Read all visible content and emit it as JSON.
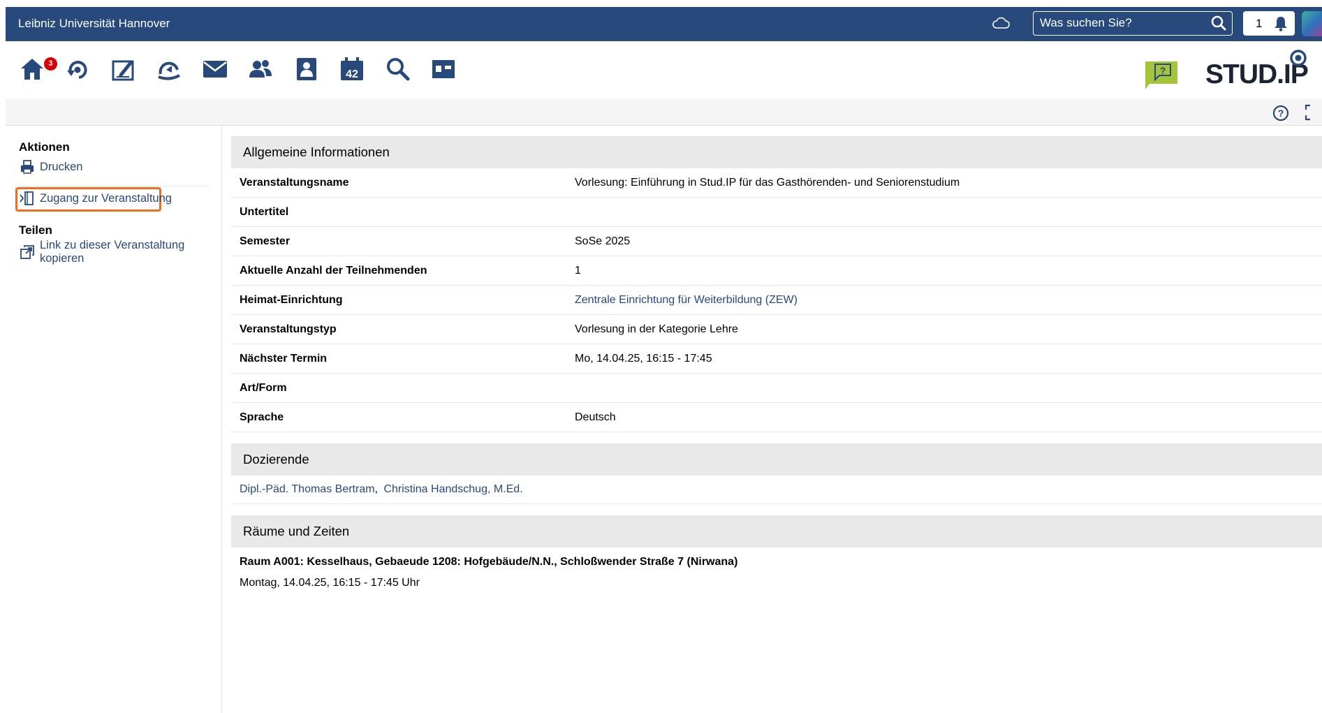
{
  "topbar": {
    "university": "Leibniz Universität Hannover",
    "search_placeholder": "Was suchen Sie?",
    "notification_count": "1"
  },
  "nav": {
    "home_badge": "3",
    "icons": [
      "home-icon",
      "courses-icon",
      "edit-icon",
      "community-icon",
      "mail-icon",
      "contacts-icon",
      "profile-icon",
      "calendar-icon",
      "search-icon",
      "files-icon"
    ],
    "calendar_day": "42",
    "logo": "STUD.IP"
  },
  "sidebar": {
    "actions_title": "Aktionen",
    "print_label": "Drucken",
    "access_label": "Zugang zur Veranstaltung",
    "share_title": "Teilen",
    "copy_link_label": "Link zu dieser Veranstaltung kopieren"
  },
  "general": {
    "title": "Allgemeine Informationen",
    "rows": [
      {
        "key": "Veranstaltungsname",
        "value": "Vorlesung: Einführung in Stud.IP für das Gasthörenden- und Seniorenstudium",
        "link": false
      },
      {
        "key": "Untertitel",
        "value": "",
        "link": false
      },
      {
        "key": "Semester",
        "value": "SoSe 2025",
        "link": false
      },
      {
        "key": "Aktuelle Anzahl der Teilnehmenden",
        "value": "1",
        "link": false
      },
      {
        "key": "Heimat-Einrichtung",
        "value": "Zentrale Einrichtung für Weiterbildung (ZEW)",
        "link": true
      },
      {
        "key": "Veranstaltungstyp",
        "value": "Vorlesung in der Kategorie Lehre",
        "link": false
      },
      {
        "key": "Nächster Termin",
        "value": "Mo, 14.04.25, 16:15 - 17:45",
        "link": false
      },
      {
        "key": "Art/Form",
        "value": "",
        "link": false
      },
      {
        "key": "Sprache",
        "value": "Deutsch",
        "link": false
      }
    ]
  },
  "lecturers": {
    "title": "Dozierende",
    "names": [
      "Dipl.-Päd. Thomas Bertram",
      "Christina Handschug, M.Ed."
    ],
    "separator": ", "
  },
  "rooms": {
    "title": "Räume und Zeiten",
    "room": "Raum A001: Kesselhaus, Gebaeude 1208: Hofgebäude/N.N., Schloßwender Straße 7 (Nirwana)",
    "time": "Montag, 14.04.25, 16:15 - 17:45 Uhr"
  },
  "colors": {
    "topbar": "#28497c",
    "link": "#28497c",
    "highlight": "#f26e1e",
    "badge": "#d60000"
  }
}
